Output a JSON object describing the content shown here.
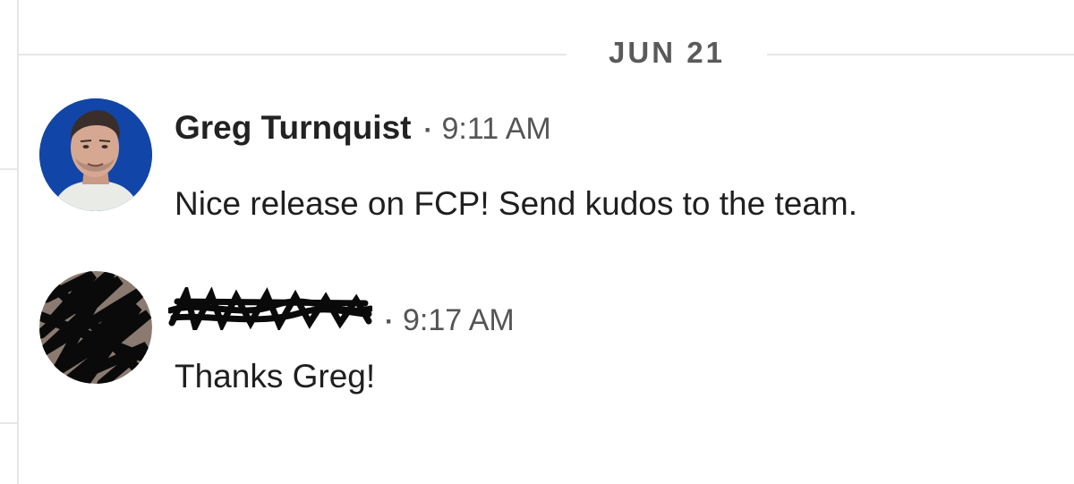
{
  "divider": {
    "date": "JUN 21"
  },
  "messages": [
    {
      "sender": "Greg Turnquist",
      "separator": "·",
      "time": "9:11 AM",
      "body": "Nice release on FCP! Send kudos to the team.",
      "avatar": "greg-avatar-photo"
    },
    {
      "sender": "",
      "sender_redacted": true,
      "separator": "·",
      "time": "9:17 AM",
      "body": "Thanks Greg!",
      "avatar": "redacted-avatar-scribble"
    }
  ],
  "colors": {
    "divider_text": "#5a5a5a",
    "rule": "#e6e6e6",
    "sender": "#222222",
    "meta": "#555555",
    "body": "#1f1f1f",
    "avatar_bg": "#1040a0"
  }
}
